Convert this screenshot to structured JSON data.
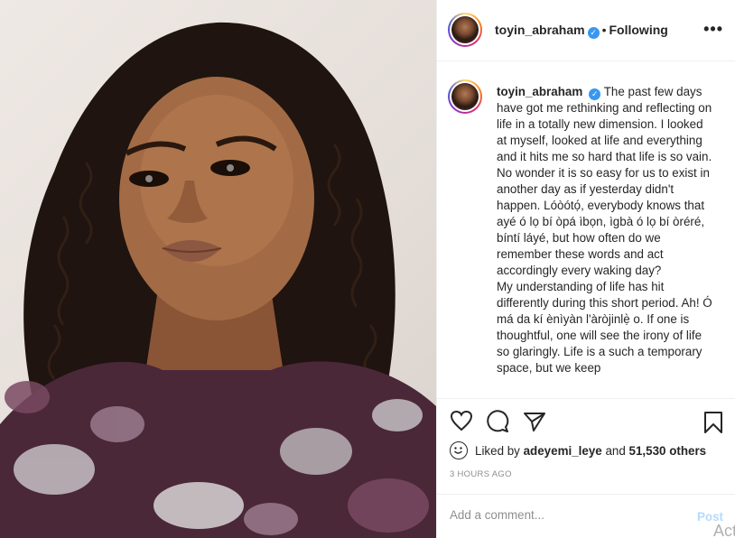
{
  "post": {
    "username": "toyin_abraham",
    "verified_glyph": "✓",
    "separator": "•",
    "follow_status": "Following",
    "more_glyph": "•••",
    "caption_lines": [
      "The past few days have got me rethinking and reflecting on life in a totally new dimension. I looked at myself, looked at life and everything and it hits me so hard that life is so vain. No wonder it is so easy for us to exist in another day as if yesterday didn't happen. Lóòótọ́, everybody knows that ayé ó lọ bí òpá ìbọn, ìgbà ó lọ bí òréré, bíntí láyé, but how often do we remember these words and act accordingly every waking day?",
      "My understanding of life has hit differently during this short period. Ah! Ó má da kí ènìyàn l'àròjinlẹ̀ o. If one is thoughtful, one will see the irony of life so glaringly. Life is a such a temporary space, but we keep"
    ],
    "likes_prefix": "Liked by",
    "liked_by_user": "adeyemi_leye",
    "likes_conjunction": "and",
    "likes_others": "51,530 others",
    "timestamp": "3 HOURS AGO",
    "comment_placeholder": "Add a comment...",
    "post_button": "Post",
    "watermark": "Act"
  },
  "icons": {
    "like": "heart-icon",
    "comment": "comment-icon",
    "share": "send-icon",
    "save": "bookmark-icon",
    "emoji": "smiley-icon"
  },
  "colors": {
    "verified": "#3897f0",
    "post_button": "#b3dbff",
    "muted_text": "#8e8e8e"
  }
}
